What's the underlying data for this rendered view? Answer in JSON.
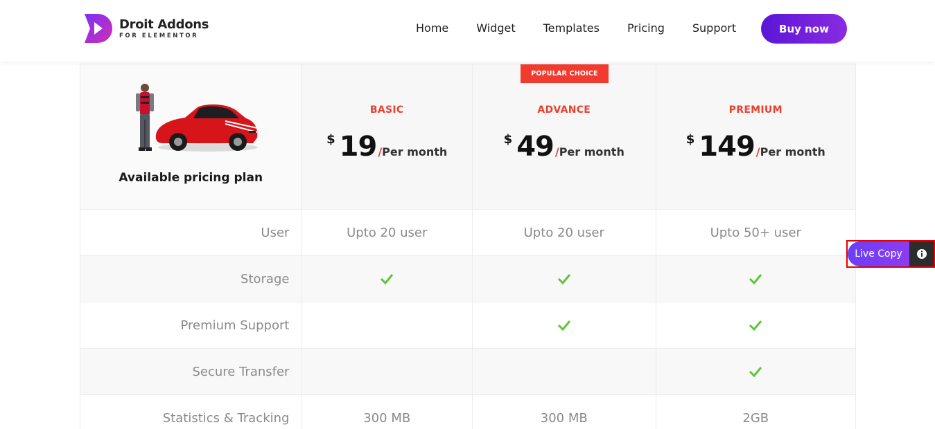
{
  "brand": {
    "title": "Droit Addons",
    "subtitle": "FOR ELEMENTOR"
  },
  "nav": {
    "items": [
      "Home",
      "Widget",
      "Templates",
      "Pricing",
      "Support"
    ],
    "cta": "Buy now"
  },
  "table": {
    "intro_label": "Available pricing plan",
    "badge": "POPULAR CHOICE",
    "plans": [
      {
        "name": "BASIC",
        "currency": "$",
        "amount": "19",
        "period": "Per month"
      },
      {
        "name": "ADVANCE",
        "currency": "$",
        "amount": "49",
        "period": "Per month"
      },
      {
        "name": "PREMIUM",
        "currency": "$",
        "amount": "149",
        "period": "Per month"
      }
    ],
    "features": [
      {
        "label": "User",
        "values": [
          "Upto 20 user",
          "Upto 20 user",
          "Upto 50+ user"
        ]
      },
      {
        "label": "Storage",
        "checks": [
          true,
          true,
          true
        ]
      },
      {
        "label": "Premium Support",
        "checks": [
          false,
          true,
          true
        ]
      },
      {
        "label": "Secure Transfer",
        "checks": [
          false,
          false,
          true
        ]
      },
      {
        "label": "Statistics & Tracking",
        "values": [
          "300 MB",
          "300 MB",
          "2GB"
        ]
      }
    ]
  },
  "live_copy": {
    "label": "Live Copy",
    "info_icon": "info-icon"
  },
  "colors": {
    "accent": "#e8412f",
    "brand_purple": "#5b16d6",
    "check_green": "#5cc53a"
  }
}
